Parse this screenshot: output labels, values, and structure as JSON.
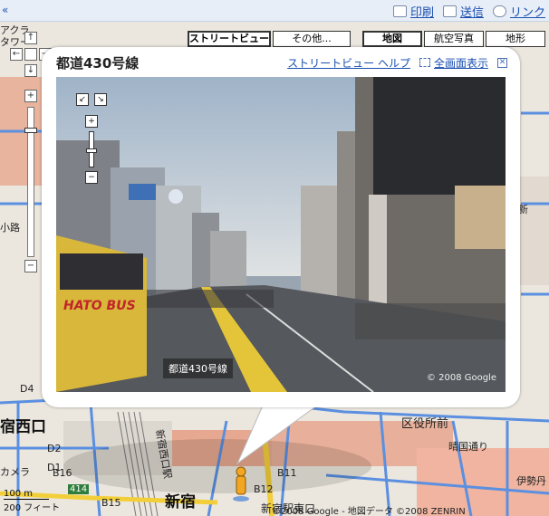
{
  "top_bar": {
    "collapse_glyph": "«",
    "links": [
      {
        "label": "印刷",
        "icon": "print-icon"
      },
      {
        "label": "送信",
        "icon": "mail-icon"
      },
      {
        "label": "リンク",
        "icon": "link-icon"
      }
    ]
  },
  "map_type": {
    "streetview_label": "ストリートビュー",
    "other_label": "その他...",
    "map_label": "地図",
    "aerial_label": "航空写真",
    "terrain_label": "地形",
    "active": "地図"
  },
  "zoom": {
    "pan_up": "↑",
    "pan_left": "←",
    "pan_right": "→",
    "pan_down": "↓",
    "zoom_in": "+",
    "zoom_out": "−"
  },
  "info_window": {
    "title": "都道430号線",
    "streetview_help_label": "ストリートビュー ヘルプ",
    "fullscreen_label": "全画面表示",
    "close_glyph": "✕"
  },
  "panorama": {
    "road_label": "都道430号線",
    "copyright": "© 2008 Google",
    "bus_text": "HATO BUS",
    "zoom_in": "+",
    "zoom_out": "−",
    "expand_glyphs": [
      "↙",
      "↘"
    ]
  },
  "map_labels": {
    "station_west": "宿西口",
    "shinjuku": "新宿",
    "kubyo_front": "区役所前",
    "seiko_street": "晴国通り",
    "camera": "カメラ",
    "shinjuku_east": "新宿駅東口",
    "isetan": "伊勢丹",
    "label_d4": "D4",
    "label_d2": "D2",
    "label_d1": "D1",
    "label_b16": "B16",
    "label_b11": "B11",
    "label_b12": "B12",
    "label_b15": "B15",
    "label_414": "414",
    "label_ata": "アクラ",
    "label_tower": "タワー",
    "label_sho": "小路",
    "label_ni": "新",
    "label_shin": "新宿西口駅"
  },
  "scale": {
    "meters": "100 m",
    "feet": "200 フィート"
  },
  "attribution": "©2008 Google - 地図データ ©2008 ZENRIN"
}
